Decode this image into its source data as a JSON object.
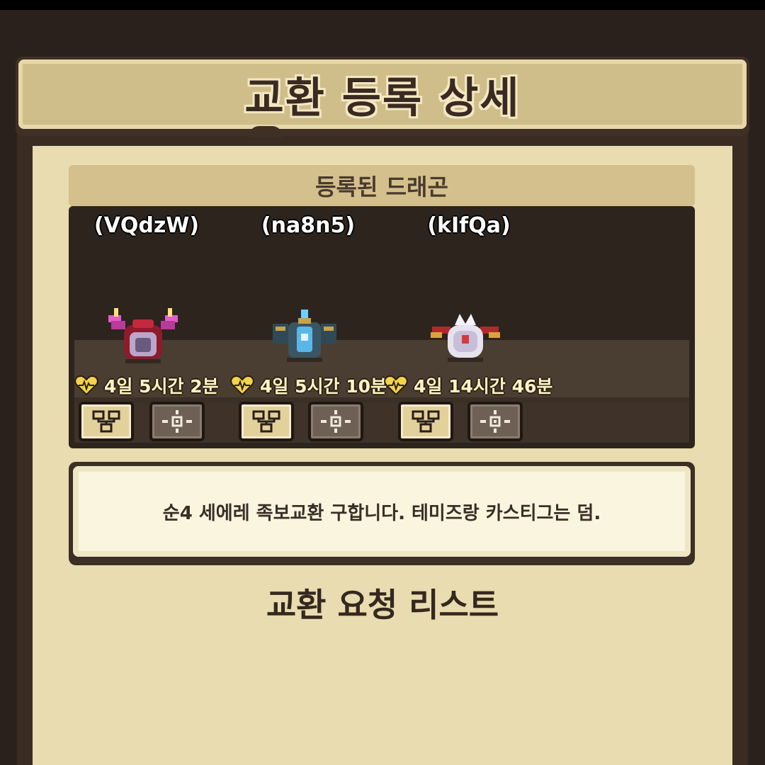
{
  "header": {
    "title": "교환 등록 상세"
  },
  "registered": {
    "label": "등록된 드래곤"
  },
  "dragons": [
    {
      "name": "(VQdzW)",
      "timer": "4일 5시간 2분",
      "sprite": "red-dragon-icon"
    },
    {
      "name": "(na8n5)",
      "timer": "4일 5시간 10분",
      "sprite": "blue-dragon-icon"
    },
    {
      "name": "(kIfQa)",
      "timer": "4일 14시간 46분",
      "sprite": "white-dragon-icon"
    }
  ],
  "buttons": {
    "tree_icon": "family-tree-icon",
    "locate_icon": "locate-icon"
  },
  "message": {
    "text": "순4 세에레 족보교환 구합니다. 테미즈랑 카스티그는 덤."
  },
  "request_list": {
    "title": "교환 요청 리스트"
  }
}
